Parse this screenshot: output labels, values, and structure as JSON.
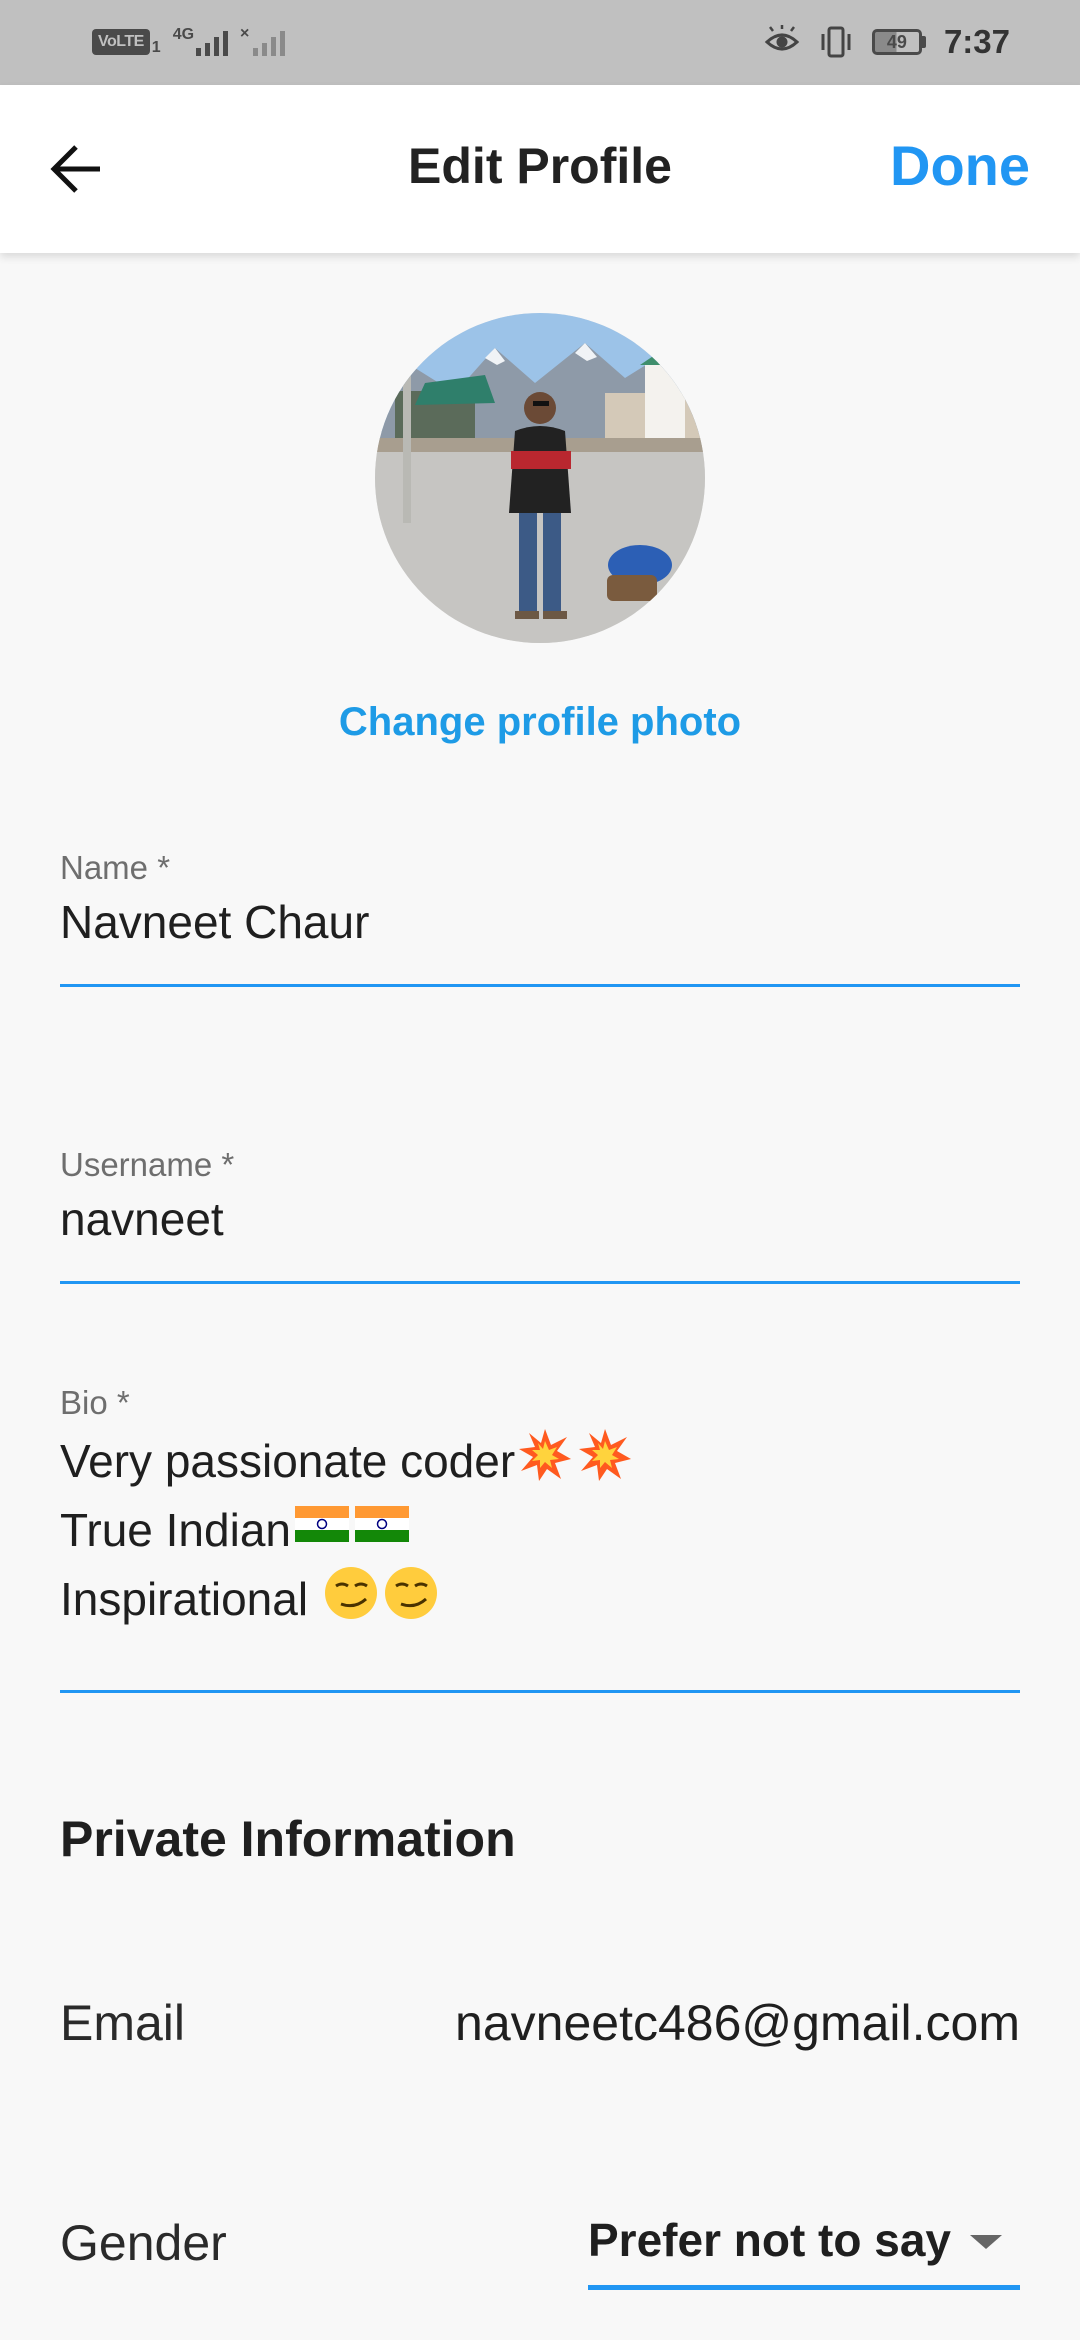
{
  "status_bar": {
    "volte": "VoLTE",
    "sim_number": "1",
    "network_type": "4G",
    "signal_x": "×",
    "battery_level": "49",
    "battery_fraction": 0.49,
    "time": "7:37"
  },
  "app_bar": {
    "title": "Edit Profile",
    "done_label": "Done"
  },
  "profile": {
    "change_photo_label": "Change profile photo"
  },
  "form": {
    "name": {
      "label": "Name *",
      "value": "Navneet Chaur"
    },
    "username": {
      "label": "Username *",
      "value": "navneet"
    },
    "bio": {
      "label": "Bio *",
      "lines": [
        {
          "text": "Very passionate coder",
          "emoji": "collision"
        },
        {
          "text": "True Indian",
          "emoji": "flag-india"
        },
        {
          "text": "Inspirational ",
          "emoji": "smirking-face"
        }
      ]
    }
  },
  "private_info": {
    "section_title": "Private Information",
    "email": {
      "label": "Email",
      "value": "navneetc486@gmail.com"
    },
    "gender": {
      "label": "Gender",
      "value": "Prefer not to say"
    }
  },
  "colors": {
    "accent": "#2196f3",
    "link": "#1e9be6",
    "status_bar_bg": "#c0c0c0",
    "page_bg": "#f8f8f8"
  }
}
